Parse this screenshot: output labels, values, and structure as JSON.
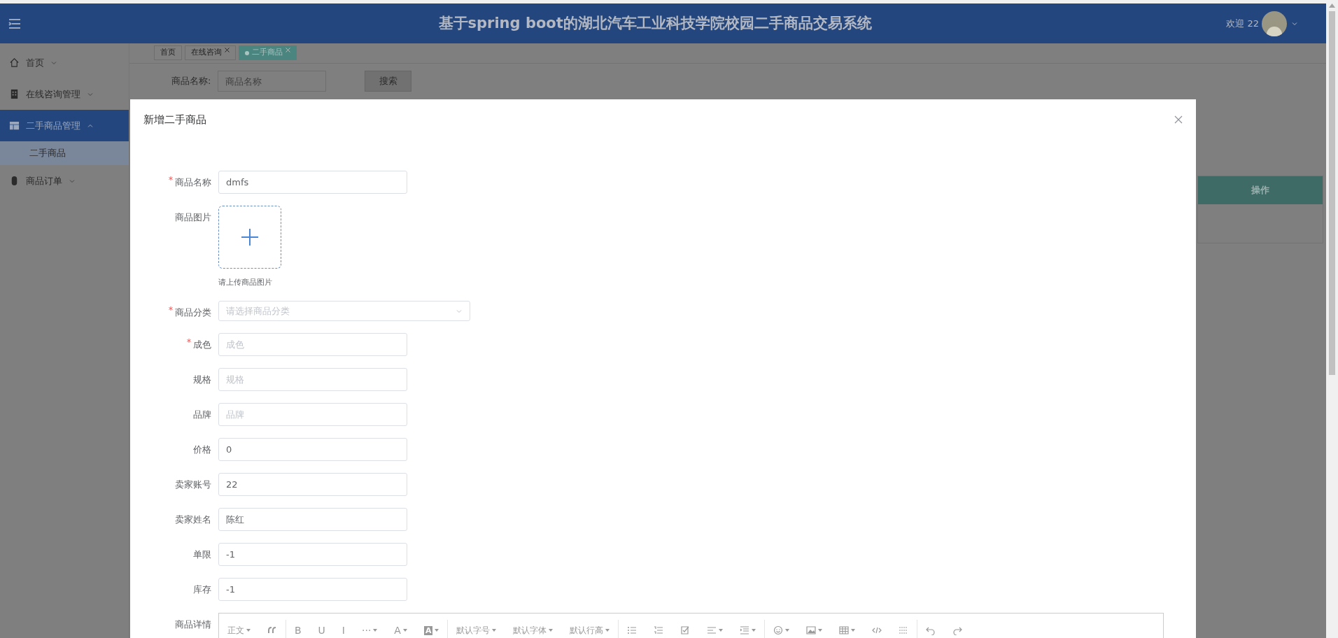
{
  "header": {
    "title": "基于spring boot的湖北汽车工业科技学院校园二手商品交易系统",
    "greeting": "欢迎 22"
  },
  "sidebar": {
    "items": [
      {
        "label": "首页",
        "kind": "home",
        "expanded": false,
        "selected": false
      },
      {
        "label": "在线咨询管理",
        "kind": "building",
        "expanded": false,
        "selected": false
      },
      {
        "label": "二手商品管理",
        "kind": "layout",
        "expanded": true,
        "selected": true,
        "children": [
          {
            "label": "二手商品",
            "selected": true
          }
        ]
      },
      {
        "label": "商品订单",
        "kind": "mouse",
        "expanded": false,
        "selected": false
      }
    ]
  },
  "tabs": [
    {
      "label": "首页",
      "selected": false,
      "closable": false
    },
    {
      "label": "在线咨询",
      "selected": false,
      "closable": true
    },
    {
      "label": "二手商品",
      "selected": true,
      "closable": true
    }
  ],
  "search": {
    "label": "商品名称:",
    "placeholder": "商品名称",
    "button": "搜索"
  },
  "table": {
    "columns": [
      "操作"
    ]
  },
  "dialog": {
    "title": "新增二手商品",
    "fields": [
      {
        "label": "商品名称",
        "kind": "text",
        "required": true,
        "value": "dmfs"
      },
      {
        "label": "商品图片",
        "kind": "upload",
        "required": false,
        "hint": "请上传商品图片"
      },
      {
        "label": "商品分类",
        "kind": "select",
        "required": true,
        "placeholder": "请选择商品分类"
      },
      {
        "label": "成色",
        "kind": "text",
        "required": true,
        "placeholder": "成色"
      },
      {
        "label": "规格",
        "kind": "text",
        "required": false,
        "placeholder": "规格"
      },
      {
        "label": "品牌",
        "kind": "text",
        "required": false,
        "placeholder": "品牌"
      },
      {
        "label": "价格",
        "kind": "text",
        "required": false,
        "value": "0"
      },
      {
        "label": "卖家账号",
        "kind": "text",
        "required": false,
        "value": "22"
      },
      {
        "label": "卖家姓名",
        "kind": "text",
        "required": false,
        "value": "陈红"
      },
      {
        "label": "单限",
        "kind": "text",
        "required": false,
        "value": "-1"
      },
      {
        "label": "库存",
        "kind": "text",
        "required": false,
        "value": "-1"
      },
      {
        "label": "商品详情",
        "kind": "editor",
        "required": false
      }
    ]
  },
  "toolbar": [
    [
      {
        "kind": "text",
        "label": "正文",
        "caret": true
      },
      {
        "kind": "quote",
        "caret": false
      }
    ],
    [
      {
        "kind": "glyph",
        "label": "B",
        "caret": false
      },
      {
        "kind": "glyph",
        "label": "U",
        "caret": false
      },
      {
        "kind": "glyph",
        "label": "I",
        "caret": false
      },
      {
        "kind": "glyph",
        "label": "···",
        "caret": true
      },
      {
        "kind": "glyph",
        "label": "A",
        "caret": true
      },
      {
        "kind": "boxed",
        "label": "A",
        "caret": true
      }
    ],
    [
      {
        "kind": "text",
        "label": "默认字号",
        "caret": true
      },
      {
        "kind": "text",
        "label": "默认字体",
        "caret": true
      },
      {
        "kind": "text",
        "label": "默认行高",
        "caret": true
      }
    ],
    [
      {
        "kind": "bullets",
        "caret": false
      },
      {
        "kind": "numbers",
        "caret": false
      },
      {
        "kind": "todo",
        "caret": false
      },
      {
        "kind": "align",
        "caret": true
      },
      {
        "kind": "indent",
        "caret": true
      }
    ],
    [
      {
        "kind": "emoji",
        "caret": true
      },
      {
        "kind": "image",
        "caret": true
      },
      {
        "kind": "table",
        "caret": true
      },
      {
        "kind": "code",
        "caret": false
      },
      {
        "kind": "divider",
        "caret": false
      }
    ],
    [
      {
        "kind": "undo",
        "caret": false
      },
      {
        "kind": "redo",
        "caret": false
      }
    ]
  ]
}
